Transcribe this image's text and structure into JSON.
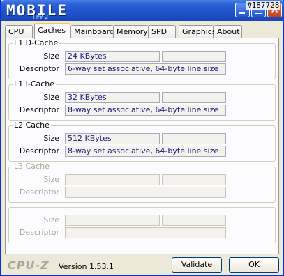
{
  "window": {
    "title": "MOBILE",
    "subtitle": "ГРУ 2",
    "watermark": "#187728",
    "minimize_icon": "minimize-icon",
    "maximize_icon": "maximize-icon",
    "close_icon": "close-icon",
    "close_glyph": "✕"
  },
  "tabs": [
    {
      "label": "CPU"
    },
    {
      "label": "Caches"
    },
    {
      "label": "Mainboard"
    },
    {
      "label": "Memory"
    },
    {
      "label": "SPD"
    },
    {
      "label": "Graphics"
    },
    {
      "label": "About"
    }
  ],
  "active_tab": "Caches",
  "groups": {
    "l1d": {
      "title": "L1 D-Cache",
      "size_label": "Size",
      "size": "24 KBytes",
      "size_extra": "",
      "descriptor_label": "Descriptor",
      "descriptor": "6-way set associative, 64-byte line size"
    },
    "l1i": {
      "title": "L1 I-Cache",
      "size_label": "Size",
      "size": "32 KBytes",
      "size_extra": "",
      "descriptor_label": "Descriptor",
      "descriptor": "8-way set associative, 64-byte line size"
    },
    "l2": {
      "title": "L2 Cache",
      "size_label": "Size",
      "size": "512 KBytes",
      "size_extra": "",
      "descriptor_label": "Descriptor",
      "descriptor": "8-way set associative, 64-byte line size"
    },
    "l3": {
      "title": "L3 Cache",
      "size_label": "Size",
      "size": "",
      "size_extra": "",
      "descriptor_label": "Descriptor",
      "descriptor": ""
    },
    "extra": {
      "title": "",
      "size_label": "Size",
      "size": "",
      "size_extra": "",
      "descriptor_label": "Descriptor",
      "descriptor": ""
    }
  },
  "footer": {
    "brand": "CPU-Z",
    "version": "Version 1.53.1",
    "validate_label": "Validate",
    "ok_label": "OK"
  }
}
